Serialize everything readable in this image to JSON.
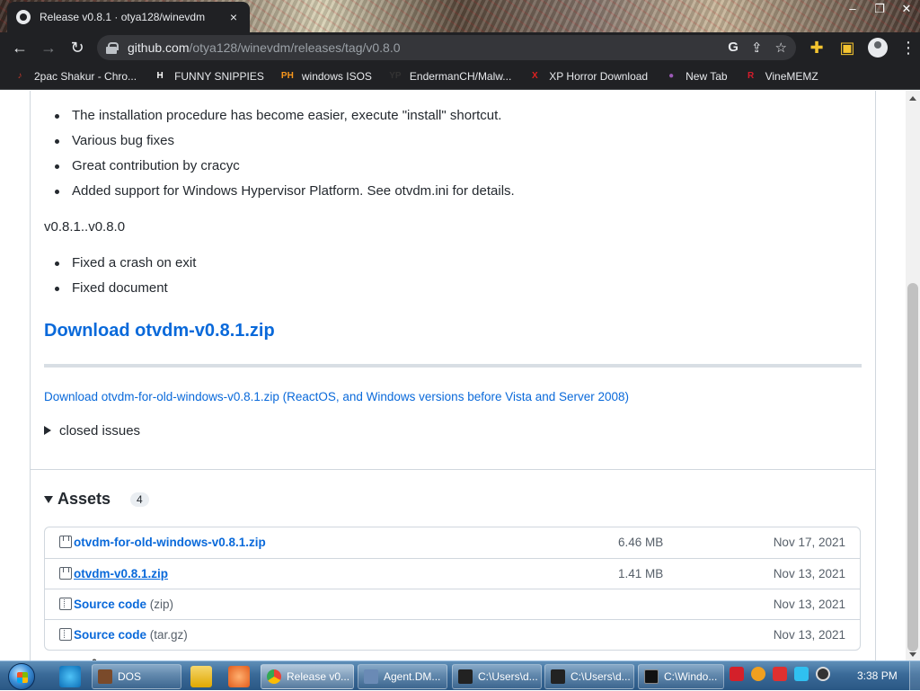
{
  "browser": {
    "tab_title": "Release v0.8.1 · otya128/winevdm",
    "close_glyph": "×",
    "window_controls": [
      "–",
      "❐",
      "✕"
    ],
    "url_host": "github.com",
    "url_path": "/otya128/winevdm/releases/tag/v0.8.0",
    "bookmarks": [
      {
        "label": "2pac Shakur - Chro...",
        "icon": "bookmark-2pac-icon",
        "color": "#c0392b",
        "glyph": "♪"
      },
      {
        "label": "FUNNY SNIPPIES",
        "icon": "bookmark-h-icon",
        "color": "#ffffff",
        "glyph": "H"
      },
      {
        "label": "windows ISOS",
        "icon": "bookmark-ph-icon",
        "color": "#f7971d",
        "glyph": "PH"
      },
      {
        "label": "EndermanCH/Malw...",
        "icon": "bookmark-yp-icon",
        "color": "#333333",
        "glyph": "YP"
      },
      {
        "label": "XP Horror Download",
        "icon": "bookmark-x-icon",
        "color": "#e02020",
        "glyph": "X"
      },
      {
        "label": "New Tab",
        "icon": "bookmark-newtab-icon",
        "color": "#9b59b6",
        "glyph": "●"
      },
      {
        "label": "VineMEMZ",
        "icon": "bookmark-r-icon",
        "color": "#d41c2c",
        "glyph": "R"
      }
    ]
  },
  "release": {
    "list1": [
      "The installation procedure has become easier, execute \"install\" shortcut.",
      "Various bug fixes",
      "Great contribution by cracyc",
      "Added support for Windows Hypervisor Platform. See otvdm.ini for details."
    ],
    "range": "v0.8.1..v0.8.0",
    "list2": [
      "Fixed a crash on exit",
      "Fixed document"
    ],
    "download_heading": "Download otvdm-v0.8.1.zip",
    "download_old": "Download otvdm-for-old-windows-v0.8.1.zip (ReactOS, and Windows versions before Vista and Server 2008)",
    "closed_issues": "closed issues",
    "assets_title": "Assets",
    "assets_count": "4",
    "assets": [
      {
        "name": "otvdm-for-old-windows-v0.8.1.zip",
        "sub": "",
        "size": "6.46 MB",
        "date": "Nov 17, 2021",
        "icon": "package-icon"
      },
      {
        "name": "otvdm-v0.8.1.zip",
        "sub": "",
        "size": "1.41 MB",
        "date": "Nov 13, 2021",
        "icon": "package-icon"
      },
      {
        "name": "Source code",
        "sub": " (zip)",
        "size": "",
        "date": "Nov 13, 2021",
        "icon": "file-zip-icon"
      },
      {
        "name": "Source code",
        "sub": " (tar.gz)",
        "size": "",
        "date": "Nov 13, 2021",
        "icon": "file-zip-icon"
      }
    ]
  },
  "taskbar": {
    "items": [
      {
        "label": "DOS",
        "color": "#7a4a2a"
      },
      {
        "label": "Release v0...",
        "color": "#34a853",
        "active": true
      },
      {
        "label": "Agent.DM...",
        "color": "#6a8ab5"
      },
      {
        "label": "C:\\Users\\d...",
        "color": "#222222"
      },
      {
        "label": "C:\\Users\\d...",
        "color": "#222222"
      },
      {
        "label": "C:\\Windo...",
        "color": "#111111"
      }
    ],
    "clock": "3:38 PM"
  }
}
